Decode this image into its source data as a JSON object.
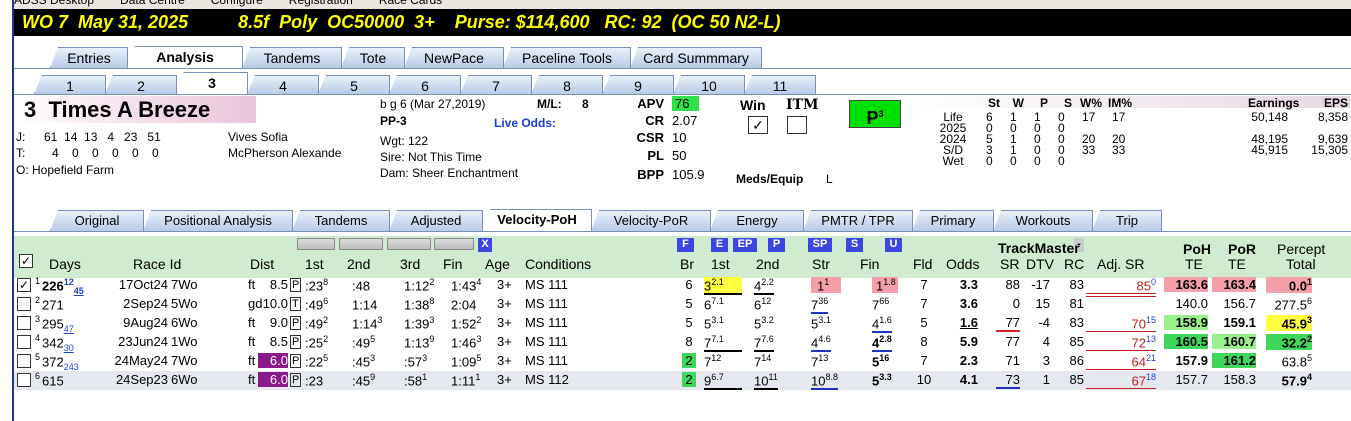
{
  "top_strip": [
    "ADSS Desktop",
    "Data Centre",
    "Configure",
    "Registration",
    "Race Cards"
  ],
  "title": "WO 7  May 31, 2025          8.5f  Poly  OC50000  3+    Purse: $114,600   RC: 92  (OC 50 N2-L)",
  "main_tabs": [
    "Entries",
    "Analysis",
    "Tandems",
    "Tote",
    "NewPace",
    "Paceline Tools",
    "Card Summmary"
  ],
  "main_tab_selected": "Analysis",
  "num_tabs": [
    "1",
    "2",
    "3",
    "4",
    "5",
    "6",
    "7",
    "8",
    "9",
    "10",
    "11"
  ],
  "num_tab_selected": "3",
  "horse": {
    "name": "3  Times A Breeze",
    "desc": "b g 6 (Mar 27,2019)",
    "ml_label": "M/L:",
    "ml": "8",
    "pp": "PP-3",
    "live_odds": "Live Odds:",
    "j_label": "J:",
    "j_stats": "61  14  13   4   23   51",
    "jockey": "Vives Sofia",
    "t_label": "T:",
    "t_stats": "4    0    0    0    0    0",
    "trainer": "McPherson Alexande",
    "owner": "O: Hopefield Farm",
    "wgt": "Wgt: 122",
    "sire": "Sire: Not This Time",
    "dam": "Dam: Sheer Enchantment"
  },
  "ratings": [
    {
      "label": "APV",
      "value": "76"
    },
    {
      "label": "CR",
      "value": "2.07"
    },
    {
      "label": "CSR",
      "value": "10"
    },
    {
      "label": "PL",
      "value": "50"
    },
    {
      "label": "BPP",
      "value": "105.9"
    }
  ],
  "win_label": "Win",
  "itm_label": "ITM",
  "win_check": "✓",
  "meds_label": "Meds/Equip",
  "meds": "L",
  "p_badge": "P",
  "p_sup": "3",
  "stats": {
    "headers": [
      "St",
      "W",
      "P",
      "S",
      "W%",
      "IM%",
      "Earnings",
      "EPS"
    ],
    "rows": [
      {
        "label": "Life",
        "v": [
          "6",
          "1",
          "1",
          "0",
          "17",
          "17",
          "50,148",
          "8,358"
        ]
      },
      {
        "label": "2025",
        "v": [
          "0",
          "0",
          "0",
          "0",
          "",
          "",
          "",
          ""
        ]
      },
      {
        "label": "2024",
        "v": [
          "5",
          "1",
          "0",
          "0",
          "20",
          "20",
          "48,195",
          "9,639"
        ]
      },
      {
        "label": "S/D",
        "v": [
          "3",
          "1",
          "0",
          "0",
          "33",
          "33",
          "45,915",
          "15,305"
        ]
      },
      {
        "label": "Wet",
        "v": [
          "0",
          "0",
          "0",
          "0",
          "",
          "",
          "",
          ""
        ]
      }
    ]
  },
  "sub_tabs": [
    "Original",
    "Positional Analysis",
    "Tandems",
    "Adjusted",
    "Velocity-PoH",
    "Velocity-PoR",
    "Energy",
    "PMTR / TPR",
    "Primary",
    "Workouts",
    "Trip"
  ],
  "sub_tab_selected": "Velocity-PoH",
  "col_headers": {
    "days": "Days",
    "raceid": "Race Id",
    "dist": "Dist",
    "c1": "1st",
    "c2": "2nd",
    "c3": "3rd",
    "fin": "Fin",
    "age": "Age",
    "cond": "Conditions",
    "br": "Br",
    "p1": "1st",
    "p2": "2nd",
    "str": "Str",
    "pfin": "Fin",
    "fld": "Fld",
    "odds": "Odds",
    "tm": "TrackMaster",
    "sr": "SR",
    "dtv": "DTV",
    "rc": "RC",
    "adj": "Adj. SR",
    "poh": "PoH",
    "por": "PoR",
    "te1": "TE",
    "te2": "TE",
    "pct": "Percept",
    "total": "Total"
  },
  "btn_labels": {
    "x": "X",
    "f": "F",
    "e": "E",
    "ep": "EP",
    "p": "P",
    "sp": "SP",
    "s": "S",
    "u": "U",
    "minus": "-"
  },
  "rows": [
    {
      "n": "1",
      "days": "226",
      "dsup": "12",
      "dsub": "45",
      "date": "17Oct24",
      "trk": "7Wo",
      "sfc": "ft",
      "dist": "8.5",
      "tag": "P",
      "c1": ":23",
      "c1s": "8",
      "c2": ":48",
      "c3": "1:12",
      "c3s": "2",
      "fin": "1:43",
      "fins": "4",
      "age": "3+",
      "cond": "MS 111",
      "br": "6",
      "p1": "3",
      "p1s": "2.1",
      "p2": "4",
      "p2s": "2.2",
      "str": "1",
      "strs": "1",
      "pf": "1",
      "pfs": "1.8",
      "fld": "7",
      "odds": "3.3",
      "sr": "88",
      "dtv": "-17",
      "rc": "83",
      "adj": "85",
      "adjs": "0",
      "poh": "163.6",
      "por": "163.4",
      "pct": "0.0",
      "pcts": "1"
    },
    {
      "n": "2",
      "days": "271",
      "dsup": "",
      "dsub": "",
      "date": "2Sep24",
      "trk": "5Wo",
      "sfc": "gd",
      "dist": "10.0",
      "tag": "T",
      "c1": ":49",
      "c1s": "6",
      "c2": "1:14",
      "c3": "1:38",
      "c3s": "8",
      "fin": "2:04",
      "fins": "",
      "age": "3+",
      "cond": "MS 111",
      "br": "5",
      "p1": "6",
      "p1s": "7.1",
      "p2": "6",
      "p2s": "12",
      "str": "7",
      "strs": "36",
      "pf": "7",
      "pfs": "66",
      "fld": "7",
      "odds": "3.6",
      "sr": "0",
      "dtv": "15",
      "rc": "81",
      "adj": "",
      "adjs": "",
      "poh": "140.0",
      "por": "156.7",
      "pct": "277.5",
      "pcts": "6"
    },
    {
      "n": "3",
      "days": "295",
      "dsup": "",
      "dsub": "47",
      "date": "9Aug24",
      "trk": "6Wo",
      "sfc": "ft",
      "dist": "9.0",
      "tag": "P",
      "c1": ":49",
      "c1s": "2",
      "c2": "1:14",
      "c2s": "3",
      "c3": "1:39",
      "c3s": "3",
      "fin": "1:52",
      "fins": "2",
      "age": "3+",
      "cond": "MS 111",
      "br": "5",
      "p1": "5",
      "p1s": "3.1",
      "p2": "5",
      "p2s": "3.2",
      "str": "5",
      "strs": "3.1",
      "pf": "4",
      "pfs": "1.6",
      "fld": "5",
      "odds": "1.6",
      "sr": "77",
      "dtv": "-4",
      "rc": "83",
      "adj": "70",
      "adjs": "15",
      "poh": "158.9",
      "por": "159.1",
      "pct": "45.9",
      "pcts": "3"
    },
    {
      "n": "4",
      "days": "342",
      "dsup": "",
      "dsub": "30",
      "date": "23Jun24",
      "trk": "1Wo",
      "sfc": "ft",
      "dist": "8.5",
      "tag": "P",
      "c1": ":25",
      "c1s": "2",
      "c2": ":49",
      "c2s": "5",
      "c3": "1:13",
      "c3s": "9",
      "fin": "1:46",
      "fins": "3",
      "age": "3+",
      "cond": "MS 111",
      "br": "8",
      "p1": "7",
      "p1s": "7.1",
      "p2": "7",
      "p2s": "7.6",
      "str": "4",
      "strs": "4.6",
      "pf": "4",
      "pfs": "2.8",
      "fld": "8",
      "odds": "5.9",
      "sr": "77",
      "dtv": "4",
      "rc": "85",
      "adj": "72",
      "adjs": "13",
      "poh": "160.5",
      "por": "160.7",
      "pct": "32.2",
      "pcts": "2"
    },
    {
      "n": "5",
      "days": "372",
      "dsup": "",
      "dsub": "243",
      "date": "24May24",
      "trk": "7Wo",
      "sfc": "ft",
      "dist": "6.0",
      "tag": "P",
      "c1": ":22",
      "c1s": "5",
      "c2": ":45",
      "c2s": "3",
      "c3": ":57",
      "c3s": "3",
      "fin": "1:09",
      "fins": "5",
      "age": "3+",
      "cond": "MS 111",
      "br": "2",
      "p1": "7",
      "p1s": "12",
      "p2": "7",
      "p2s": "14",
      "str": "7",
      "strs": "13",
      "pf": "5",
      "pfs": "16",
      "fld": "7",
      "odds": "2.3",
      "sr": "71",
      "dtv": "3",
      "rc": "86",
      "adj": "64",
      "adjs": "21",
      "poh": "157.9",
      "por": "161.2",
      "pct": "63.8",
      "pcts": "5"
    },
    {
      "n": "6",
      "days": "615",
      "dsup": "",
      "dsub": "",
      "date": "24Sep23",
      "trk": "6Wo",
      "sfc": "ft",
      "dist": "6.0",
      "tag": "P",
      "c1": ":23",
      "c1s": "",
      "c2": ":45",
      "c2s": "9",
      "c3": ":58",
      "c3s": "1",
      "fin": "1:11",
      "fins": "1",
      "age": "3+",
      "cond": "MS 112",
      "br": "2",
      "p1": "9",
      "p1s": "6.7",
      "p2": "10",
      "p2s": "11",
      "str": "10",
      "strs": "8.8",
      "pf": "5",
      "pfs": "3.3",
      "fld": "10",
      "odds": "4.1",
      "sr": "73",
      "dtv": "1",
      "rc": "85",
      "adj": "67",
      "adjs": "18",
      "poh": "157.7",
      "por": "158.3",
      "pct": "57.9",
      "pcts": "4"
    }
  ]
}
